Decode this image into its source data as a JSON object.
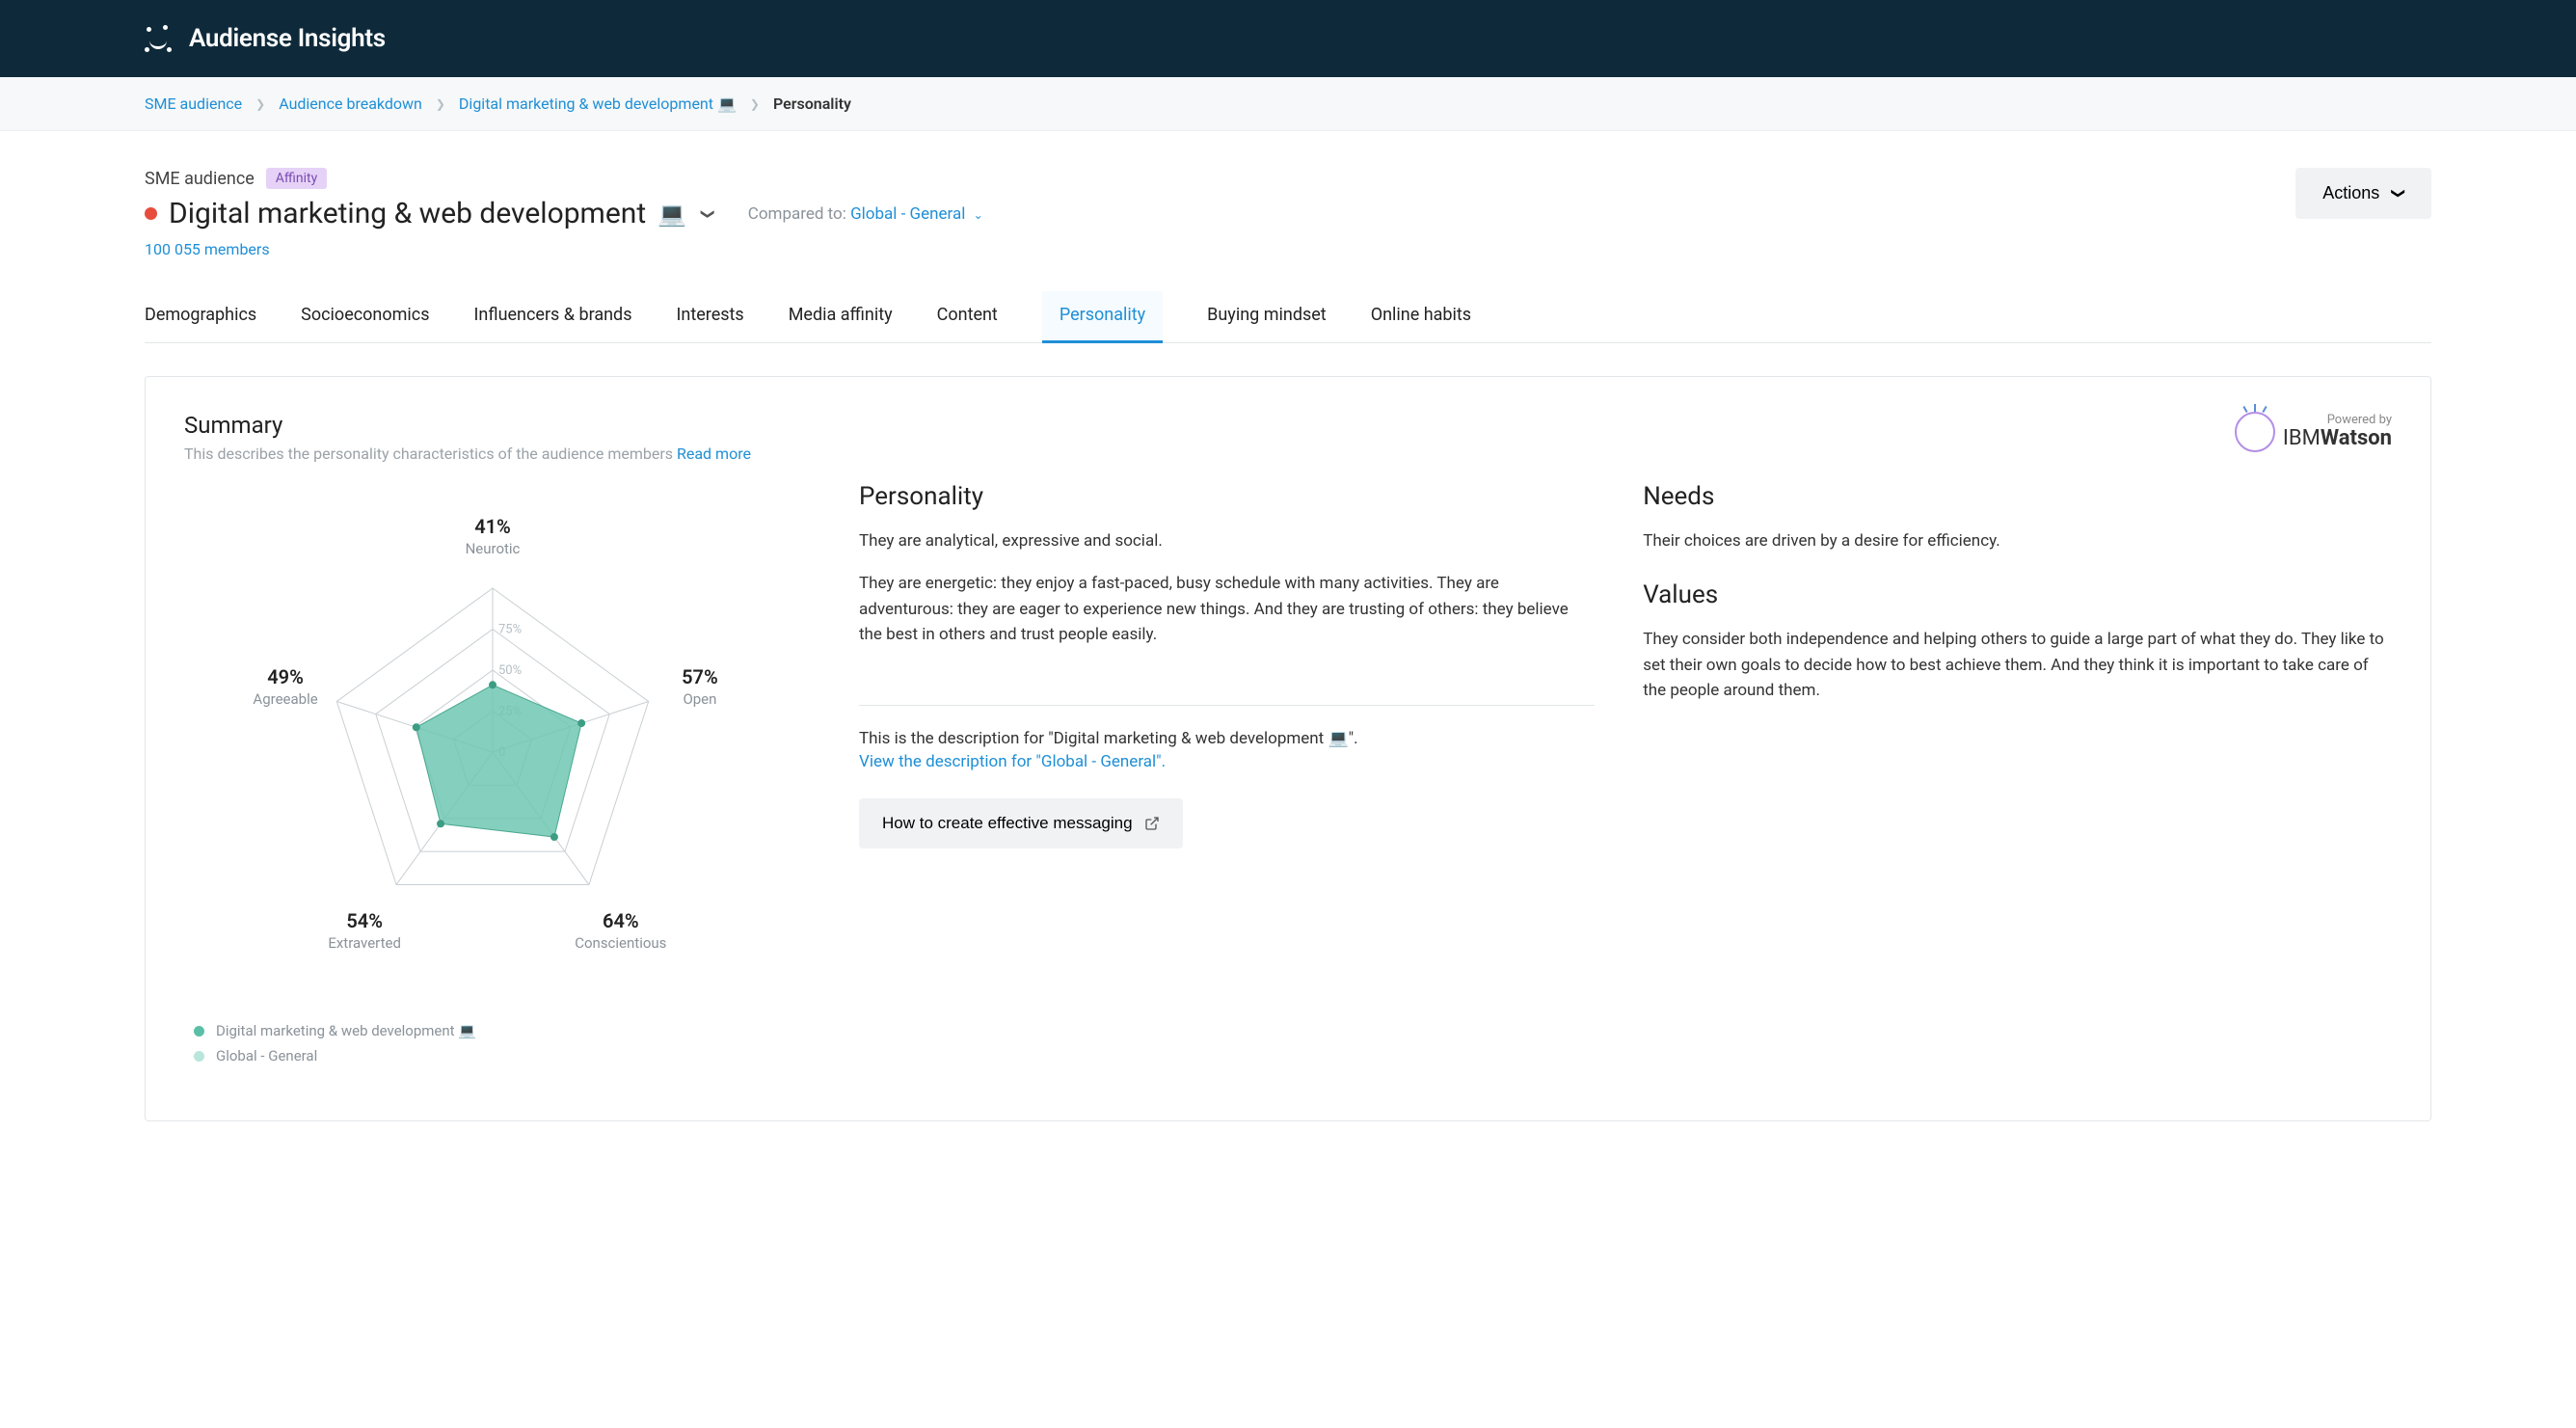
{
  "app": {
    "name": "Audiense Insights"
  },
  "breadcrumb": {
    "items": [
      "SME audience",
      "Audience breakdown",
      "Digital marketing & web development 💻"
    ],
    "current": "Personality"
  },
  "header": {
    "audience_name": "SME audience",
    "affinity_badge": "Affinity",
    "segment_title": "Digital marketing & web development",
    "segment_emoji": "💻",
    "compared_to_label": "Compared to:",
    "compared_to_value": "Global - General",
    "members": "100 055 members",
    "actions_label": "Actions"
  },
  "tabs": [
    "Demographics",
    "Socioeconomics",
    "Influencers & brands",
    "Interests",
    "Media affinity",
    "Content",
    "Personality",
    "Buying mindset",
    "Online habits"
  ],
  "active_tab": "Personality",
  "summary": {
    "title": "Summary",
    "subtitle": "This describes the personality characteristics of the audience members",
    "read_more": "Read more",
    "watson_powered": "Powered by",
    "watson_brand": "IBM",
    "watson_brand2": "Watson"
  },
  "chart_data": {
    "type": "radar",
    "rings": [
      25,
      50,
      75
    ],
    "axes": [
      {
        "label": "Neurotic",
        "value": 41
      },
      {
        "label": "Open",
        "value": 57
      },
      {
        "label": "Conscientious",
        "value": 64
      },
      {
        "label": "Extraverted",
        "value": 54
      },
      {
        "label": "Agreeable",
        "value": 49
      }
    ],
    "series": [
      {
        "name": "Digital marketing & web development 💻",
        "color": "#5bbfa8",
        "values": [
          41,
          57,
          64,
          54,
          49
        ]
      },
      {
        "name": "Global - General",
        "color": "#b8e6da",
        "values": null
      }
    ]
  },
  "personality": {
    "heading": "Personality",
    "p1": "They are analytical, expressive and social.",
    "p2": "They are energetic: they enjoy a fast-paced, busy schedule with many activities. They are adventurous: they are eager to experience new things. And they are trusting of others: they believe the best in others and trust people easily."
  },
  "needs": {
    "heading": "Needs",
    "p1": "Their choices are driven by a desire for efficiency."
  },
  "values": {
    "heading": "Values",
    "p1": "They consider both independence and helping others to guide a large part of what they do. They like to set their own goals to decide how to best achieve them. And they think it is important to take care of the people around them."
  },
  "footer": {
    "desc_text": "This is the description for \"Digital marketing & web development 💻\".",
    "view_link": "View the description for \"Global - General\".",
    "howto": "How to create effective messaging"
  }
}
